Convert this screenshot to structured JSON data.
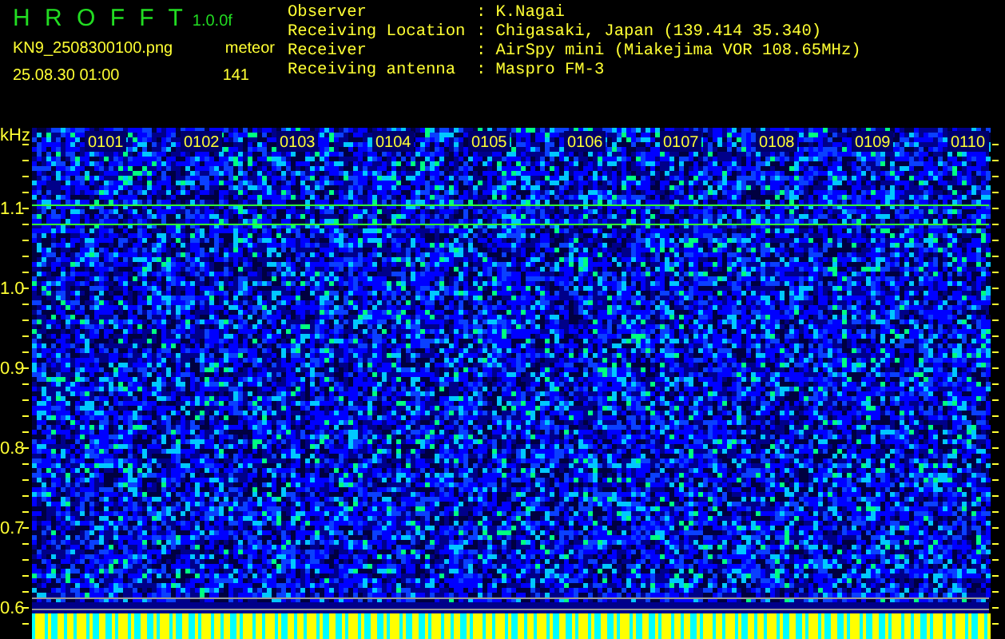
{
  "header": {
    "title": "H R O F F T",
    "version": "1.0.0f",
    "filename": "KN9_2508300100.png",
    "datetime": "25.08.30 01:00",
    "count_label": "meteor",
    "count": "141"
  },
  "info": [
    {
      "label": "Observer",
      "separator": ":",
      "value": "K.Nagai"
    },
    {
      "label": "Receiving Location",
      "separator": ":",
      "value": "Chigasaki, Japan (139.414 35.340)"
    },
    {
      "label": "Receiver",
      "separator": ":",
      "value": "AirSpy mini (Miakejima VOR 108.65MHz)"
    },
    {
      "label": "Receiving antenna",
      "separator": ":",
      "value": "Maspro FM-3"
    }
  ],
  "spectrogram": {
    "y_unit": "kHz",
    "y_labels": [
      "1.1",
      "1.0",
      "0.9",
      "0.8",
      "0.7",
      "0.6"
    ],
    "time_labels": [
      "0101",
      "0102",
      "0103",
      "0104",
      "0105",
      "0106",
      "0107",
      "0108",
      "0109",
      "0110"
    ]
  }
}
